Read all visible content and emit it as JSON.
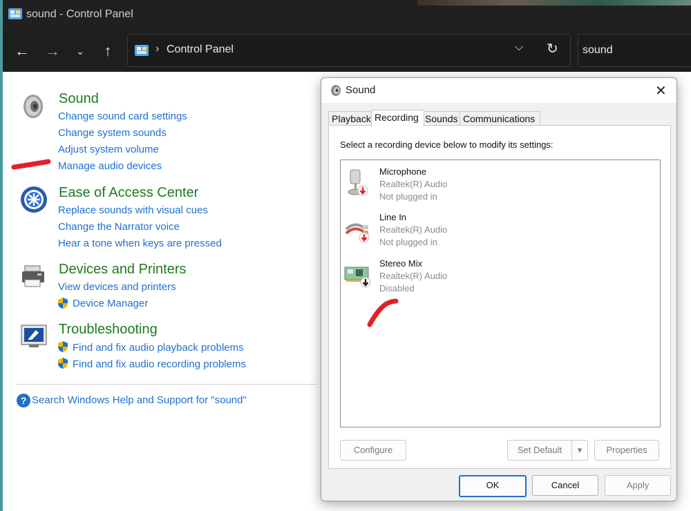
{
  "window": {
    "title": "sound - Control Panel"
  },
  "address": {
    "crumb": "Control Panel"
  },
  "search": {
    "value": "sound"
  },
  "sections": {
    "sound": {
      "title": "Sound",
      "links": [
        "Change sound card settings",
        "Change system sounds",
        "Adjust system volume",
        "Manage audio devices"
      ]
    },
    "ease": {
      "title": "Ease of Access Center",
      "links": [
        "Replace sounds with visual cues",
        "Change the Narrator voice",
        "Hear a tone when keys are pressed"
      ]
    },
    "devices": {
      "title": "Devices and Printers",
      "links": [
        "View devices and printers",
        "Device Manager"
      ]
    },
    "trouble": {
      "title": "Troubleshooting",
      "links": [
        "Find and fix audio playback problems",
        "Find and fix audio recording problems"
      ]
    }
  },
  "help": {
    "text": "Search Windows Help and Support for \"sound\""
  },
  "dialog": {
    "title": "Sound",
    "tabs": [
      "Playback",
      "Recording",
      "Sounds",
      "Communications"
    ],
    "active_tab": "Recording",
    "prompt": "Select a recording device below to modify its settings:",
    "devices": [
      {
        "name": "Microphone",
        "driver": "Realtek(R) Audio",
        "status": "Not plugged in"
      },
      {
        "name": "Line In",
        "driver": "Realtek(R) Audio",
        "status": "Not plugged in"
      },
      {
        "name": "Stereo Mix",
        "driver": "Realtek(R) Audio",
        "status": "Disabled"
      }
    ],
    "buttons": {
      "configure": "Configure",
      "set_default": "Set Default",
      "properties": "Properties",
      "ok": "OK",
      "cancel": "Cancel",
      "apply": "Apply"
    }
  },
  "colors": {
    "accent": "#1f6fd1",
    "heading_green": "#1e7a1e",
    "annotation_red": "#e0202a"
  }
}
